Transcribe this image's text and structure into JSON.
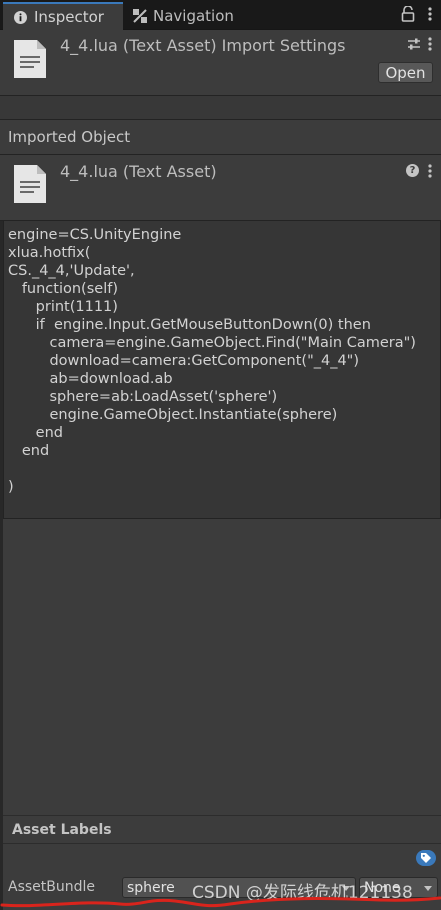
{
  "tabs": {
    "inspector": "Inspector",
    "navigation": "Navigation"
  },
  "header": {
    "title": "4_4.lua (Text Asset) Import Settings",
    "open_label": "Open"
  },
  "imported_object": {
    "heading": "Imported Object",
    "title": "4_4.lua (Text Asset)"
  },
  "code_lines": [
    "engine=CS.UnityEngine",
    "xlua.hotfix(",
    "CS._4_4,'Update',",
    "   function(self)",
    "      print(1111)",
    "      if  engine.Input.GetMouseButtonDown(0) then",
    "         camera=engine.GameObject.Find(\"Main Camera\")",
    "         download=camera:GetComponent(\"_4_4\")",
    "         ab=download.ab",
    "         sphere=ab:LoadAsset('sphere')",
    "         engine.GameObject.Instantiate(sphere)",
    "      end",
    "   end",
    "",
    ")"
  ],
  "asset_labels": {
    "heading": "Asset Labels",
    "asset_bundle_label": "AssetBundle",
    "bundle_value": "sphere",
    "variant_value": "None"
  },
  "watermark": "CSDN @发际线危机121138",
  "colors": {
    "accent": "#3a79bb",
    "annotation_red": "#d9241c"
  },
  "icons": {
    "tab_inspector": "info-icon",
    "tab_navigation": "navigation-icon",
    "lock": "lock-icon",
    "more": "kebab-menu-icon",
    "asset": "text-file-icon",
    "settings": "sliders-icon",
    "help": "help-icon",
    "labels": "tag-icon"
  }
}
